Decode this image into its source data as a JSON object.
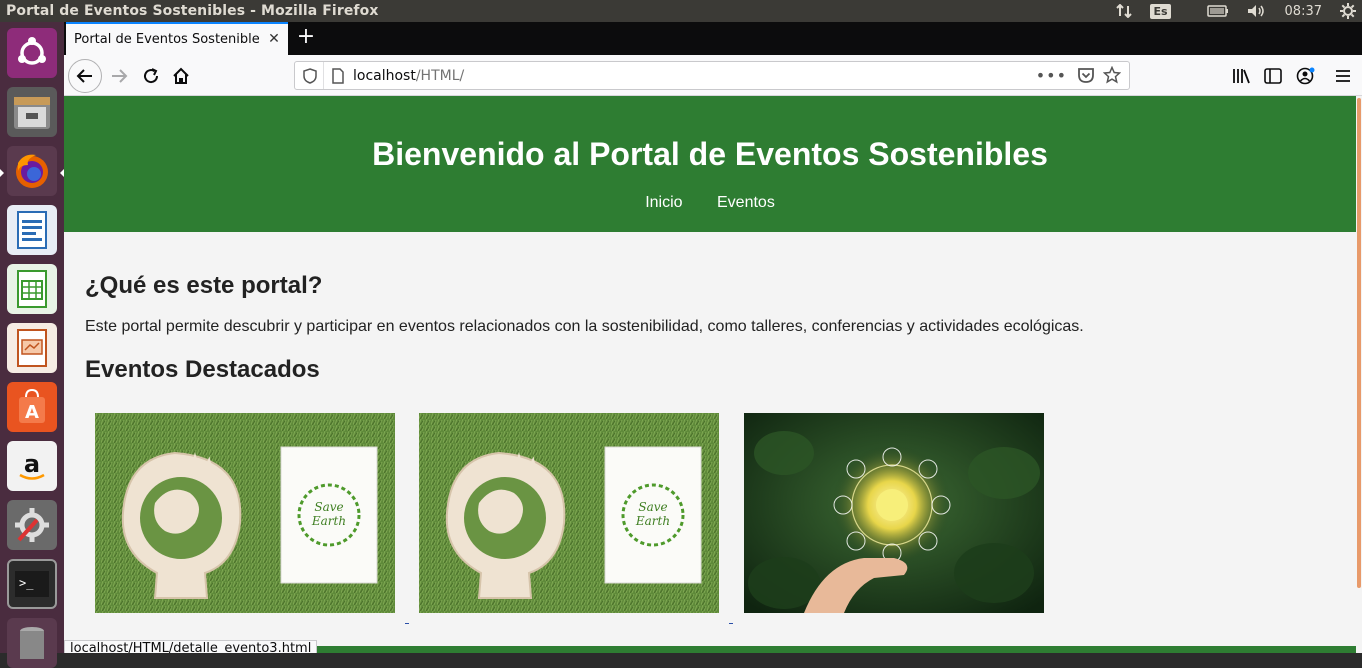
{
  "system": {
    "window_title": "Portal de Eventos Sostenibles - Mozilla Firefox",
    "keyboard_layout": "Es",
    "clock": "08:37"
  },
  "launcher": {
    "items": [
      "ubuntu-dash",
      "files",
      "firefox",
      "libreoffice-writer",
      "libreoffice-calc",
      "libreoffice-impress",
      "ubuntu-software",
      "amazon",
      "system-settings",
      "terminal",
      "trash"
    ]
  },
  "browser": {
    "tab_title": "Portal de Eventos Sostenibles",
    "url_host": "localhost",
    "url_path": "/HTML/",
    "status_url": "localhost/HTML/detalle_evento3.html"
  },
  "page": {
    "title": "Bienvenido al Portal de Eventos Sostenibles",
    "nav": {
      "home": "Inicio",
      "events": "Eventos"
    },
    "about_heading": "¿Qué es este portal?",
    "about_text": "Este portal permite descubrir y participar en eventos relacionados con la sostenibilidad, como talleres, conferencias y actividades ecológicas.",
    "featured_heading": "Eventos Destacados",
    "cards": [
      {
        "image": "save-earth-lightbulb",
        "badge_line1": "Save",
        "badge_line2": "Earth"
      },
      {
        "image": "save-earth-lightbulb",
        "badge_line1": "Save",
        "badge_line2": "Earth"
      },
      {
        "image": "hand-holding-glowing-bulb"
      }
    ]
  },
  "colors": {
    "header_green": "#2e7d32",
    "page_bg": "#f4f4f4",
    "launcher_bg": "#4a2c3f",
    "accent_blue": "#0a84ff"
  }
}
